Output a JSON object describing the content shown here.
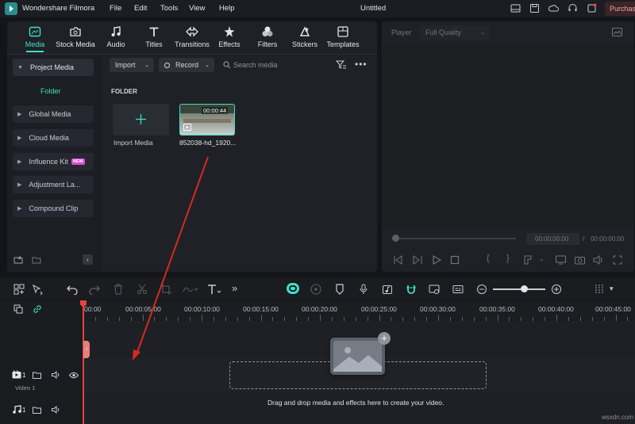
{
  "app": {
    "name": "Wondershare Filmora",
    "doc_title": "Untitled",
    "purchase": "Purchas"
  },
  "menu": [
    "File",
    "Edit",
    "Tools",
    "View",
    "Help"
  ],
  "toolbar_tabs": [
    {
      "label": "Media",
      "icon": "media-icon",
      "active": true
    },
    {
      "label": "Stock Media",
      "icon": "stock-media-icon"
    },
    {
      "label": "Audio",
      "icon": "audio-icon"
    },
    {
      "label": "Titles",
      "icon": "titles-icon"
    },
    {
      "label": "Transitions",
      "icon": "transitions-icon"
    },
    {
      "label": "Effects",
      "icon": "effects-icon"
    },
    {
      "label": "Filters",
      "icon": "filters-icon"
    },
    {
      "label": "Stickers",
      "icon": "stickers-icon"
    },
    {
      "label": "Templates",
      "icon": "templates-icon"
    }
  ],
  "sidebar": {
    "items": [
      {
        "label": "Project Media",
        "expanded": true
      },
      {
        "label": "Global Media"
      },
      {
        "label": "Cloud Media"
      },
      {
        "label": "Influence Kit",
        "badge": "NEW"
      },
      {
        "label": "Adjustment La..."
      },
      {
        "label": "Compound Clip"
      }
    ],
    "folder": "Folder"
  },
  "media": {
    "import_label": "Import",
    "record_label": "Record",
    "search_placeholder": "Search media",
    "section": "FOLDER",
    "import_tile": "Import Media",
    "clip": {
      "name": "852038-hd_1920...",
      "duration": "00:00:44"
    }
  },
  "player": {
    "label": "Player",
    "quality": "Full Quality",
    "current_time": "00:00:00:00",
    "separator": "/",
    "total_time": "00:00:00:00"
  },
  "timeline": {
    "ticks": [
      "00:00",
      "00:00:05:00",
      "00:00:10:00",
      "00:00:15:00",
      "00:00:20:00",
      "00:00:25:00",
      "00:00:30:00",
      "00:00:35:00",
      "00:00:40:00",
      "00:00:45:00"
    ],
    "tracks": [
      {
        "icon": "video-track-icon",
        "number": "1",
        "name": "Video 1"
      },
      {
        "icon": "audio-track-icon",
        "number": "1",
        "name": ""
      }
    ],
    "drop_hint": "Drag and drop media and effects here to create your video."
  },
  "watermark": "wsxdn.com",
  "colors": {
    "accent": "#3ee0c8",
    "red_playhead": "#e0453f",
    "annotation_arrow": "#d62a22",
    "badge": "#e04ad3",
    "purchase_bg": "#3a2428"
  }
}
